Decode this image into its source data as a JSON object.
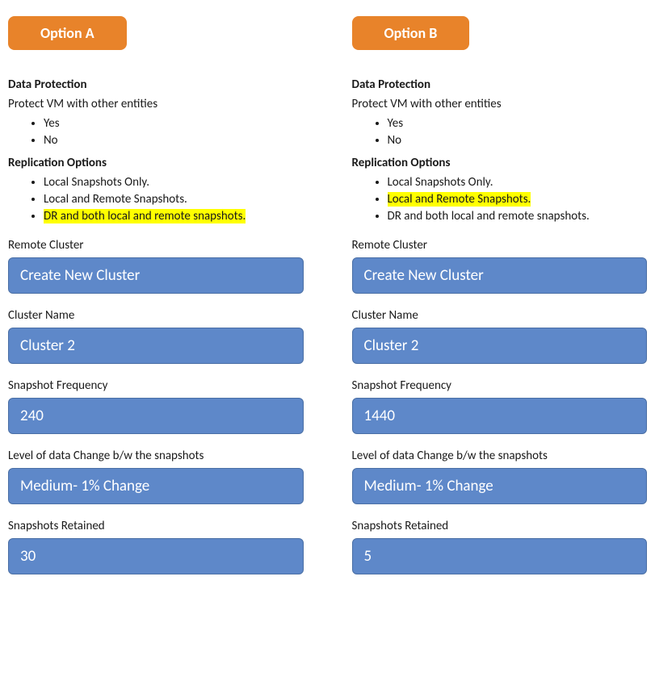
{
  "optionA": {
    "header": "Option A",
    "dataProtection": {
      "heading": "Data Protection",
      "prompt": "Protect VM with other entities",
      "choices": [
        "Yes",
        "No"
      ]
    },
    "replication": {
      "heading": "Replication Options",
      "items": [
        {
          "text": "Local Snapshots Only.",
          "highlight": false
        },
        {
          "text": "Local and Remote Snapshots.",
          "highlight": false
        },
        {
          "text": "DR and both local and remote snapshots.",
          "highlight": true
        }
      ]
    },
    "fields": [
      {
        "label": "Remote Cluster",
        "value": "Create New Cluster"
      },
      {
        "label": "Cluster Name",
        "value": "Cluster 2"
      },
      {
        "label": "Snapshot Frequency",
        "value": "240"
      },
      {
        "label": "Level of data Change b/w the snapshots",
        "value": "Medium- 1% Change"
      },
      {
        "label": "Snapshots Retained",
        "value": "30"
      }
    ]
  },
  "optionB": {
    "header": "Option B",
    "dataProtection": {
      "heading": "Data Protection",
      "prompt": "Protect VM with other entities",
      "choices": [
        "Yes",
        "No"
      ]
    },
    "replication": {
      "heading": "Replication Options",
      "items": [
        {
          "text": "Local Snapshots Only.",
          "highlight": false
        },
        {
          "text": "Local and Remote Snapshots.",
          "highlight": true
        },
        {
          "text": "DR and both local and remote snapshots.",
          "highlight": false
        }
      ]
    },
    "fields": [
      {
        "label": "Remote Cluster",
        "value": "Create New Cluster"
      },
      {
        "label": "Cluster Name",
        "value": "Cluster 2"
      },
      {
        "label": "Snapshot Frequency",
        "value": "1440"
      },
      {
        "label": "Level of data Change b/w the snapshots",
        "value": "Medium- 1% Change"
      },
      {
        "label": "Snapshots Retained",
        "value": "5"
      }
    ]
  }
}
